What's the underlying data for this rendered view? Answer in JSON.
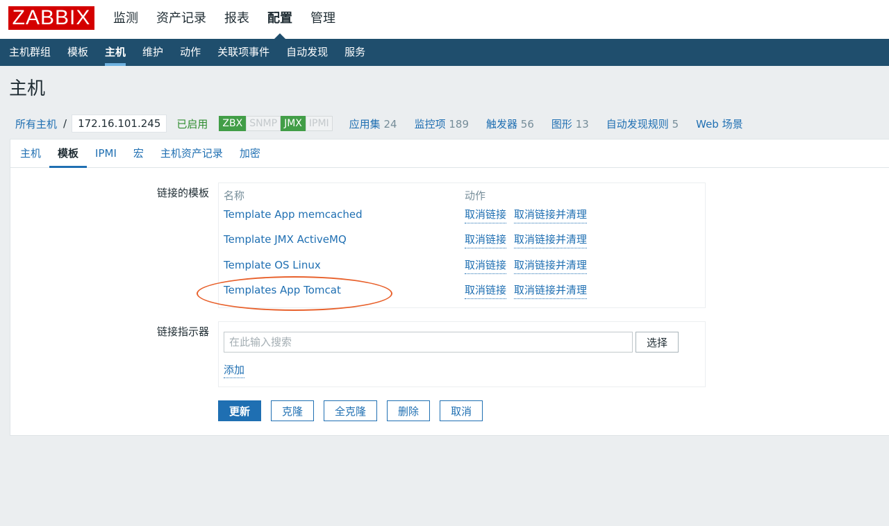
{
  "brand": {
    "logo": "ZABBIX",
    "logo_color": "#d40000"
  },
  "main_menu": [
    {
      "label": "监测"
    },
    {
      "label": "资产记录"
    },
    {
      "label": "报表"
    },
    {
      "label": "配置",
      "active": true
    },
    {
      "label": "管理"
    }
  ],
  "sub_menu": [
    {
      "label": "主机群组"
    },
    {
      "label": "模板"
    },
    {
      "label": "主机",
      "active": true
    },
    {
      "label": "维护"
    },
    {
      "label": "动作"
    },
    {
      "label": "关联项事件"
    },
    {
      "label": "自动发现"
    },
    {
      "label": "服务"
    }
  ],
  "page_title": "主机",
  "host_nav": {
    "all_hosts": "所有主机",
    "separator": "/",
    "host": "172.16.101.245",
    "status": "已启用",
    "availability": [
      {
        "label": "ZBX",
        "state": "on"
      },
      {
        "label": "SNMP",
        "state": "off"
      },
      {
        "label": "JMX",
        "state": "on"
      },
      {
        "label": "IPMI",
        "state": "off"
      }
    ],
    "links": [
      {
        "label": "应用集",
        "count": "24"
      },
      {
        "label": "监控项",
        "count": "189"
      },
      {
        "label": "触发器",
        "count": "56"
      },
      {
        "label": "图形",
        "count": "13"
      },
      {
        "label": "自动发现规则",
        "count": "5"
      },
      {
        "label": "Web 场景",
        "count": ""
      }
    ]
  },
  "tabs": [
    {
      "label": "主机"
    },
    {
      "label": "模板",
      "active": true
    },
    {
      "label": "IPMI"
    },
    {
      "label": "宏"
    },
    {
      "label": "主机资产记录"
    },
    {
      "label": "加密"
    }
  ],
  "linked_templates": {
    "label": "链接的模板",
    "col_name": "名称",
    "col_action": "动作",
    "rows": [
      {
        "name": "Template App memcached",
        "unlink": "取消链接",
        "unlink_clear": "取消链接并清理"
      },
      {
        "name": "Template JMX ActiveMQ",
        "unlink": "取消链接",
        "unlink_clear": "取消链接并清理"
      },
      {
        "name": "Template OS Linux",
        "unlink": "取消链接",
        "unlink_clear": "取消链接并清理"
      },
      {
        "name": "Templates App Tomcat",
        "unlink": "取消链接",
        "unlink_clear": "取消链接并清理"
      }
    ]
  },
  "link_indicator": {
    "label": "链接指示器",
    "placeholder": "在此输入搜索",
    "select_label": "选择",
    "add_label": "添加"
  },
  "buttons": {
    "update": "更新",
    "clone": "克隆",
    "full_clone": "全克隆",
    "delete": "删除",
    "cancel": "取消"
  },
  "colors": {
    "nav_bg": "#1f4e6d",
    "link": "#1f6fb2",
    "enabled": "#2e8c2e",
    "badge_on": "#429e47",
    "annotation": "#e8612c"
  }
}
